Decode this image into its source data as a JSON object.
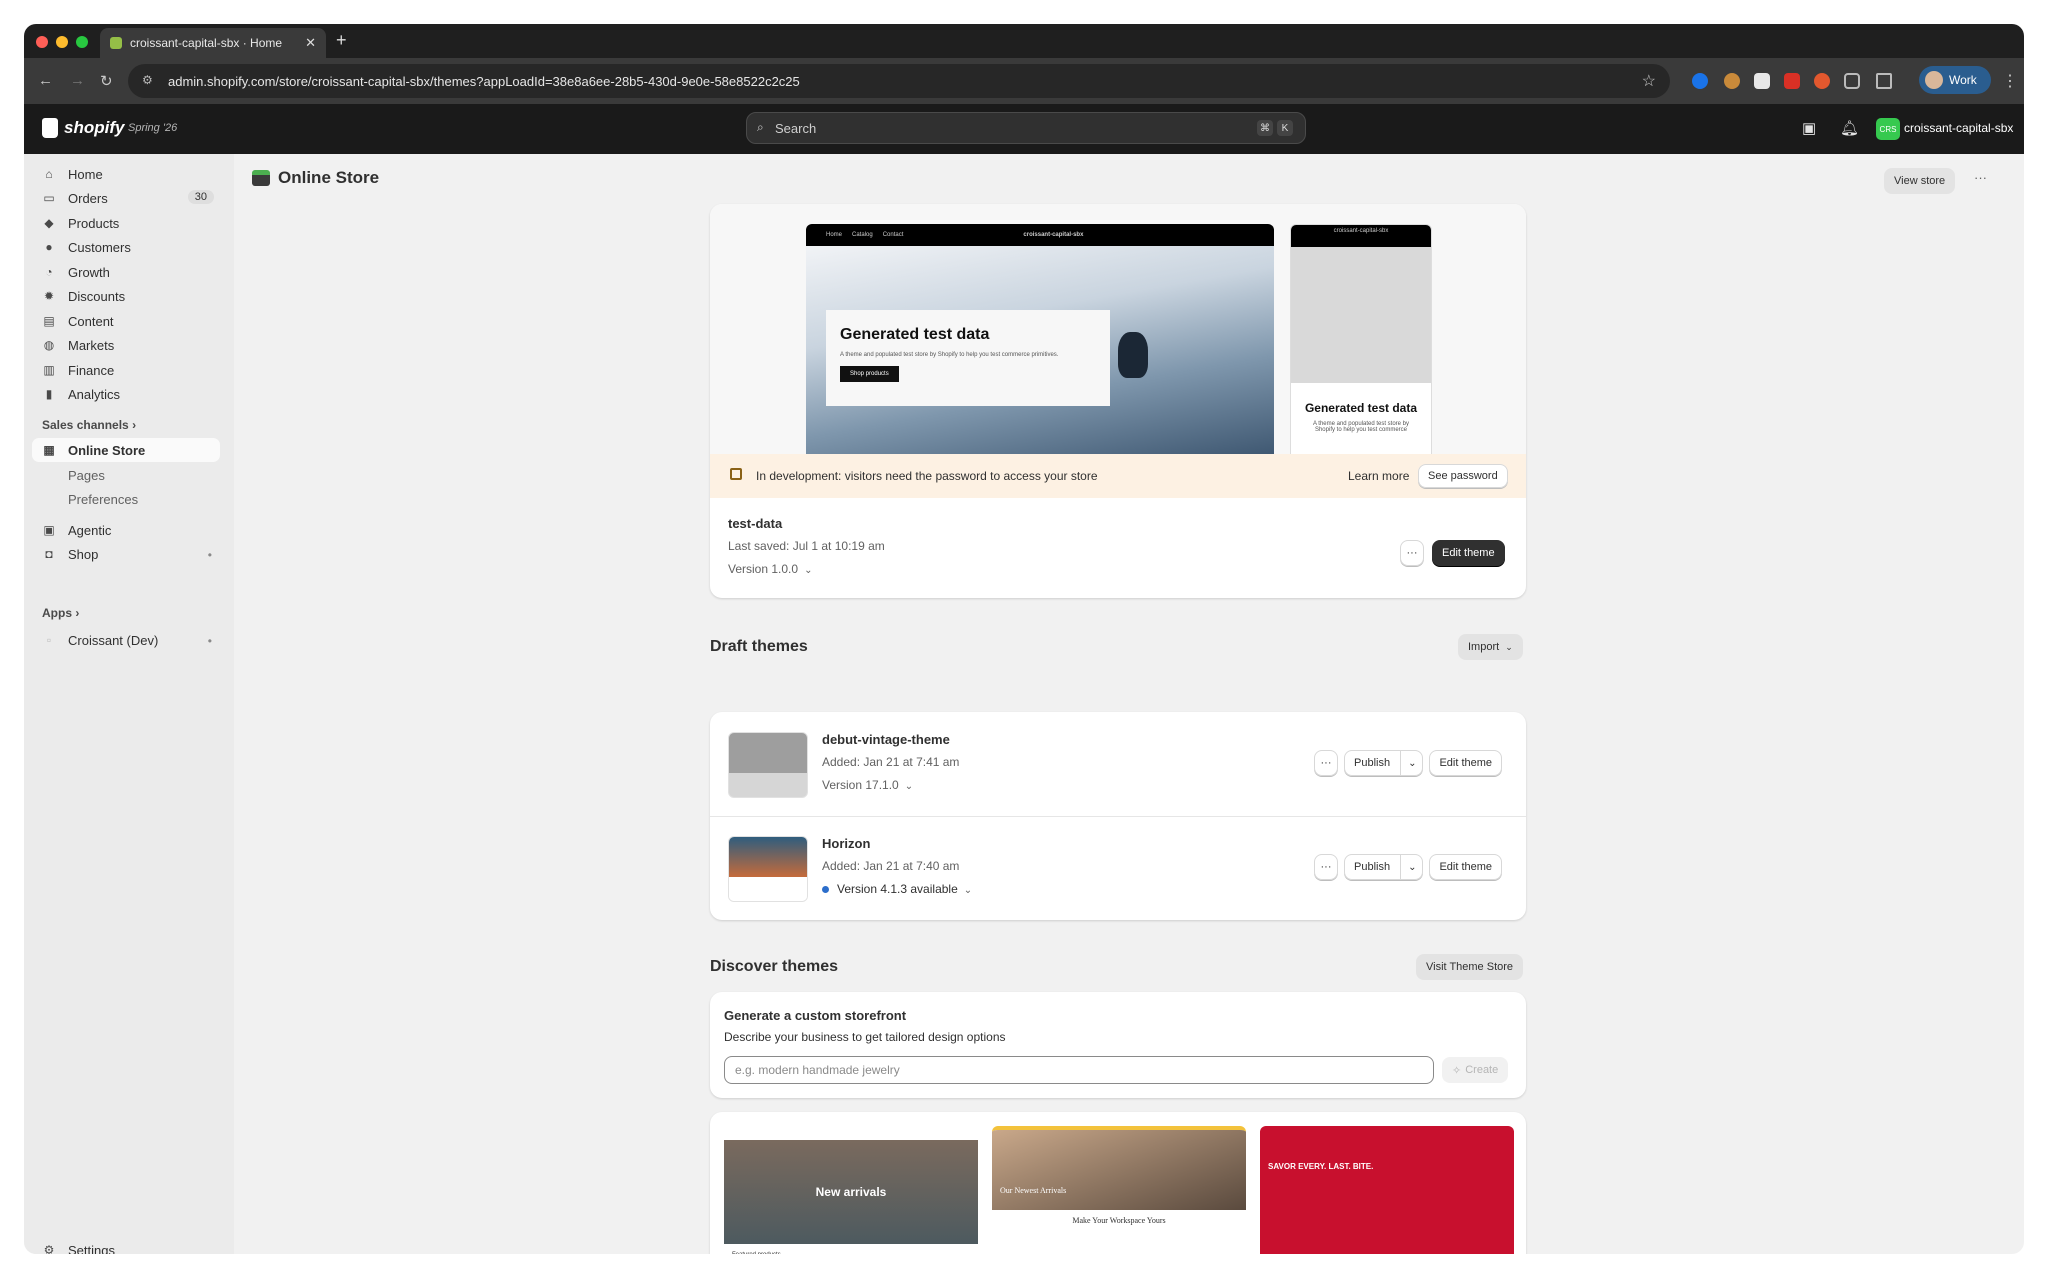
{
  "browser": {
    "tab_title": "croissant-capital-sbx · Home",
    "new_tab": "+",
    "url": "admin.shopify.com/store/croissant-capital-sbx/themes?appLoadId=38e8a6ee-28b5-430d-9e0e-58e8522c2c25",
    "profile_label": "Work"
  },
  "header": {
    "brand": "shopify",
    "edition": "Spring '26",
    "search_placeholder": "Search",
    "shortcut_cmd": "⌘",
    "shortcut_key": "K",
    "store_initials": "CRS",
    "store_name": "croissant-capital-sbx"
  },
  "sidebar": {
    "items": [
      {
        "label": "Home",
        "icon": "home-icon"
      },
      {
        "label": "Orders",
        "icon": "orders-icon",
        "badge": "30"
      },
      {
        "label": "Products",
        "icon": "tag-icon"
      },
      {
        "label": "Customers",
        "icon": "person-icon"
      },
      {
        "label": "Growth",
        "icon": "growth-icon"
      },
      {
        "label": "Discounts",
        "icon": "discount-icon"
      },
      {
        "label": "Content",
        "icon": "content-icon"
      },
      {
        "label": "Markets",
        "icon": "globe-icon"
      },
      {
        "label": "Finance",
        "icon": "bank-icon"
      },
      {
        "label": "Analytics",
        "icon": "chart-icon"
      }
    ],
    "sales_channels_label": "Sales channels",
    "online_store": "Online Store",
    "online_store_sub": [
      "Pages",
      "Preferences"
    ],
    "agentic": "Agentic",
    "shop": "Shop",
    "apps_label": "Apps",
    "app_item": "Croissant (Dev)",
    "settings": "Settings"
  },
  "page": {
    "title": "Online Store",
    "view_store": "View store",
    "more": "···"
  },
  "live_theme": {
    "desktop_nav": [
      "Home",
      "Catalog",
      "Contact"
    ],
    "store_label": "croissant-capital-sbx",
    "hero_title": "Generated test data",
    "hero_sub": "A theme and populated test store by Shopify to help you test commerce primitives.",
    "hero_button": "Shop products",
    "mobile_title": "Generated test data",
    "mobile_sub": "A theme and populated test store by Shopify to help you test commerce",
    "banner_text": "In development: visitors need the password to access your store",
    "learn_more": "Learn more",
    "see_password": "See password",
    "name": "test-data",
    "last_saved": "Last saved: Jul 1 at 10:19 am",
    "version": "Version 1.0.0",
    "more": "···",
    "edit_theme": "Edit theme"
  },
  "draft_themes": {
    "title": "Draft themes",
    "import": "Import",
    "items": [
      {
        "name": "debut-vintage-theme",
        "added": "Added: Jan 21 at 7:41 am",
        "version": "Version 17.1.0",
        "publish": "Publish",
        "edit": "Edit theme",
        "more": "···"
      },
      {
        "name": "Horizon",
        "added": "Added: Jan 21 at 7:40 am",
        "version": "Version 4.1.3 available",
        "publish": "Publish",
        "edit": "Edit theme",
        "more": "···"
      }
    ]
  },
  "discover": {
    "title": "Discover themes",
    "visit_store": "Visit Theme Store",
    "generate_title": "Generate a custom storefront",
    "generate_sub": "Describe your business to get tailored design options",
    "input_placeholder": "e.g. modern handmade jewelry",
    "create": "Create",
    "gallery": [
      {
        "caption": "New arrivals",
        "subcaption": "Featured products"
      },
      {
        "caption": "Our Newest Arrivals",
        "subcaption": "Make Your Workspace Yours"
      },
      {
        "caption": "SAVOR EVERY. LAST. BITE."
      }
    ]
  },
  "colors": {
    "accent_dark": "#303030",
    "banner_bg": "#fdf1e3",
    "store_avatar": "#36c94f",
    "update_dot": "#2c6ecb"
  }
}
